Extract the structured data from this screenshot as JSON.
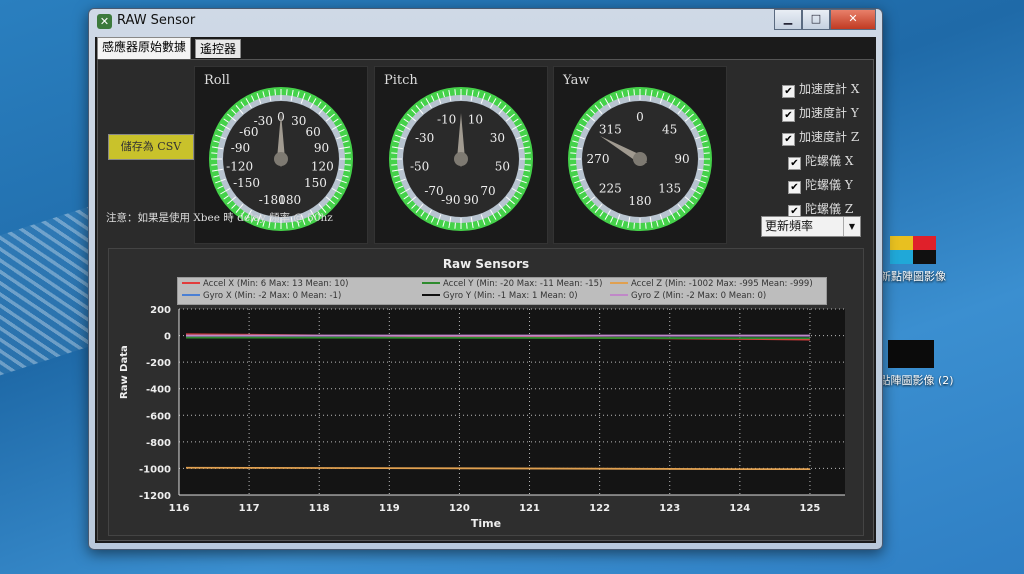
{
  "window": {
    "title": "RAW Sensor",
    "minimize": "▁",
    "maximize": "□",
    "close": "✕"
  },
  "tabs": [
    {
      "label": "感應器原始數據",
      "active": true
    },
    {
      "label": "遙控器",
      "active": false
    }
  ],
  "gauges": [
    {
      "label": "Roll",
      "min": -180,
      "max": 180,
      "value": 0,
      "ticks": [
        "-30",
        "0",
        "30",
        "-60",
        "60",
        "-90",
        "90",
        "-120",
        "120",
        "-150",
        "150",
        "-180",
        "180"
      ]
    },
    {
      "label": "Pitch",
      "min": -90,
      "max": 90,
      "value": 0,
      "ticks": [
        "-10",
        "10",
        "-30",
        "30",
        "-50",
        "50",
        "-70",
        "70",
        "-90",
        "90"
      ]
    },
    {
      "label": "Yaw",
      "min": 0,
      "max": 360,
      "value": 300,
      "ticks": [
        "0",
        "45",
        "90",
        "135",
        "180",
        "225",
        "270",
        "315"
      ]
    }
  ],
  "save_csv_label": "儲存為 CSV",
  "note": "注意：如果是使用 Xbee 時 delay 頻率 @ 50hz",
  "checkboxes": [
    {
      "label": "加速度計 X",
      "checked": true
    },
    {
      "label": "加速度計 Y",
      "checked": true
    },
    {
      "label": "加速度計 Z",
      "checked": true
    },
    {
      "label": "陀螺儀 X",
      "checked": true
    },
    {
      "label": "陀螺儀 Y",
      "checked": true
    },
    {
      "label": "陀螺儀 Z",
      "checked": true
    }
  ],
  "update_rate": {
    "selected": "更新頻率"
  },
  "desktop_icons": [
    {
      "label": "新點陣圖影像"
    },
    {
      "label": "新點陣圖影像 (2)"
    }
  ],
  "colors": {
    "accel_x": "#e23c3c",
    "accel_y": "#2e8b2e",
    "accel_z": "#e0a050",
    "gyro_x": "#4a7fd4",
    "gyro_y": "#111111",
    "gyro_z": "#c088c8",
    "gauge_green": "#45d24a",
    "gauge_dial": "#2a2a2a"
  },
  "chart_data": {
    "type": "line",
    "title": "Raw Sensors",
    "xlabel": "Time",
    "ylabel": "Raw Data",
    "xlim": [
      116,
      125.5
    ],
    "ylim": [
      -1200,
      200
    ],
    "xticks": [
      "116",
      "117",
      "118",
      "119",
      "120",
      "121",
      "122",
      "123",
      "124",
      "125"
    ],
    "yticks": [
      "200",
      "0",
      "-200",
      "-400",
      "-600",
      "-800",
      "-1000",
      "-1200"
    ],
    "grid": true,
    "legend_position": "top",
    "series": [
      {
        "name": "Accel X (Min: 6 Max: 13 Mean: 10)",
        "color_key": "accel_x",
        "x": [
          116.1,
          125
        ],
        "y": [
          10,
          -30
        ]
      },
      {
        "name": "Accel Y (Min: -20 Max: -11 Mean: -15)",
        "color_key": "accel_y",
        "x": [
          116.1,
          125
        ],
        "y": [
          -15,
          -20
        ]
      },
      {
        "name": "Accel Z (Min: -1002 Max: -995 Mean: -999)",
        "color_key": "accel_z",
        "x": [
          116.1,
          118,
          120,
          122,
          124,
          125
        ],
        "y": [
          -995,
          -997,
          -999,
          -1002,
          -1005,
          -1005
        ]
      },
      {
        "name": "Gyro X (Min: -2 Max: 0 Mean: -1)",
        "color_key": "gyro_x",
        "x": [
          116.1,
          125
        ],
        "y": [
          -1,
          -1
        ]
      },
      {
        "name": "Gyro Y (Min: -1 Max: 1 Mean: 0)",
        "color_key": "gyro_y",
        "x": [
          116.1,
          125
        ],
        "y": [
          0,
          0
        ]
      },
      {
        "name": "Gyro Z (Min: -2 Max: 0 Mean: 0)",
        "color_key": "gyro_z",
        "x": [
          116.1,
          125
        ],
        "y": [
          0,
          0
        ]
      }
    ]
  }
}
